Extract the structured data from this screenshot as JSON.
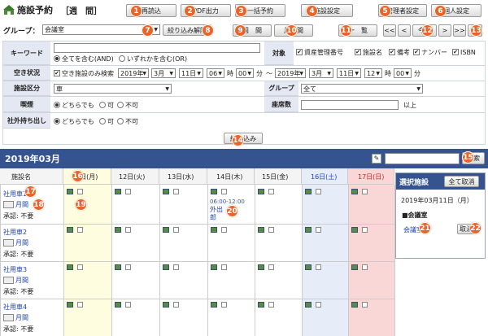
{
  "header": {
    "title": "施設予約",
    "view_mode": "［週　間］",
    "buttons": {
      "reload": "再読込",
      "pdf": "PDF出力",
      "bulk": "一括予約",
      "facility_settings": "施設設定",
      "admin_settings": "管理者設定",
      "personal_settings": "個人設定"
    }
  },
  "toolbar": {
    "group_label": "グループ：",
    "group_value": "会議室",
    "filter_clear": "絞り込み解除",
    "view_buttons": [
      "週　間",
      "月　間",
      "一　覧"
    ],
    "nav": [
      "<<",
      "<",
      "今日",
      ">",
      ">>"
    ]
  },
  "search": {
    "keyword_label": "キーワード",
    "keyword_value": "",
    "match_all": "全てを含む(AND)",
    "match_any": "いずれかを含む(OR)",
    "target_label": "対象",
    "targets": [
      "資産管理番号",
      "施設名",
      "備考",
      "ナンバー",
      "ISBN"
    ],
    "vacancy_label": "空き状況",
    "vacancy_check": "空き施設のみ検索",
    "from": {
      "year": "2019年",
      "month": "3月",
      "day": "11日",
      "hour": "06",
      "min": "00"
    },
    "to": {
      "year": "2019年",
      "month": "3月",
      "day": "11日",
      "hour": "12",
      "min": "00"
    },
    "unit_hour": "時",
    "unit_min": "分",
    "range_sep": "～",
    "category_label": "施設区分",
    "category_value": "車",
    "group_label": "グループ",
    "group_value": "全て",
    "smoking_label": "喫煙",
    "seats_label": "座席数",
    "seats_unit": "以上",
    "takeout_label": "社外持ち出し",
    "opt_any": "どちらでも",
    "opt_yes": "可",
    "opt_no": "不可",
    "submit": "絞り込み"
  },
  "calendar": {
    "month_title": "2019年03月",
    "search_button": "検索",
    "facility_col": "施設名",
    "days": [
      "11日(月)",
      "12日(火)",
      "13日(水)",
      "14日(木)",
      "15日(金)",
      "16日(土)",
      "17日(日)"
    ],
    "approval_label": "承認: 不要",
    "monthly_label": "月間",
    "rows": [
      "社用車1",
      "社用車2",
      "社用車3",
      "社用車4"
    ],
    "event": {
      "time": "06:00-12:00",
      "text": "外出",
      "person": "郎"
    }
  },
  "selected_panel": {
    "title": "選択施設",
    "cancel_all": "全て取消",
    "date": "2019年03月11日（月）",
    "group": "■会議室",
    "item": "会議室",
    "cancel": "取消"
  },
  "badges": [
    "1",
    "2",
    "3",
    "4",
    "5",
    "6",
    "7",
    "8",
    "9",
    "10",
    "11",
    "12",
    "13",
    "14",
    "15",
    "16",
    "17",
    "18",
    "19",
    "20",
    "21",
    "22"
  ],
  "colors": {
    "accent": "#e8642a",
    "header_bg": "#2f4f8f",
    "sat": "#e6ecf8",
    "sun": "#f9d7d7",
    "selected_col": "#fffde0"
  }
}
